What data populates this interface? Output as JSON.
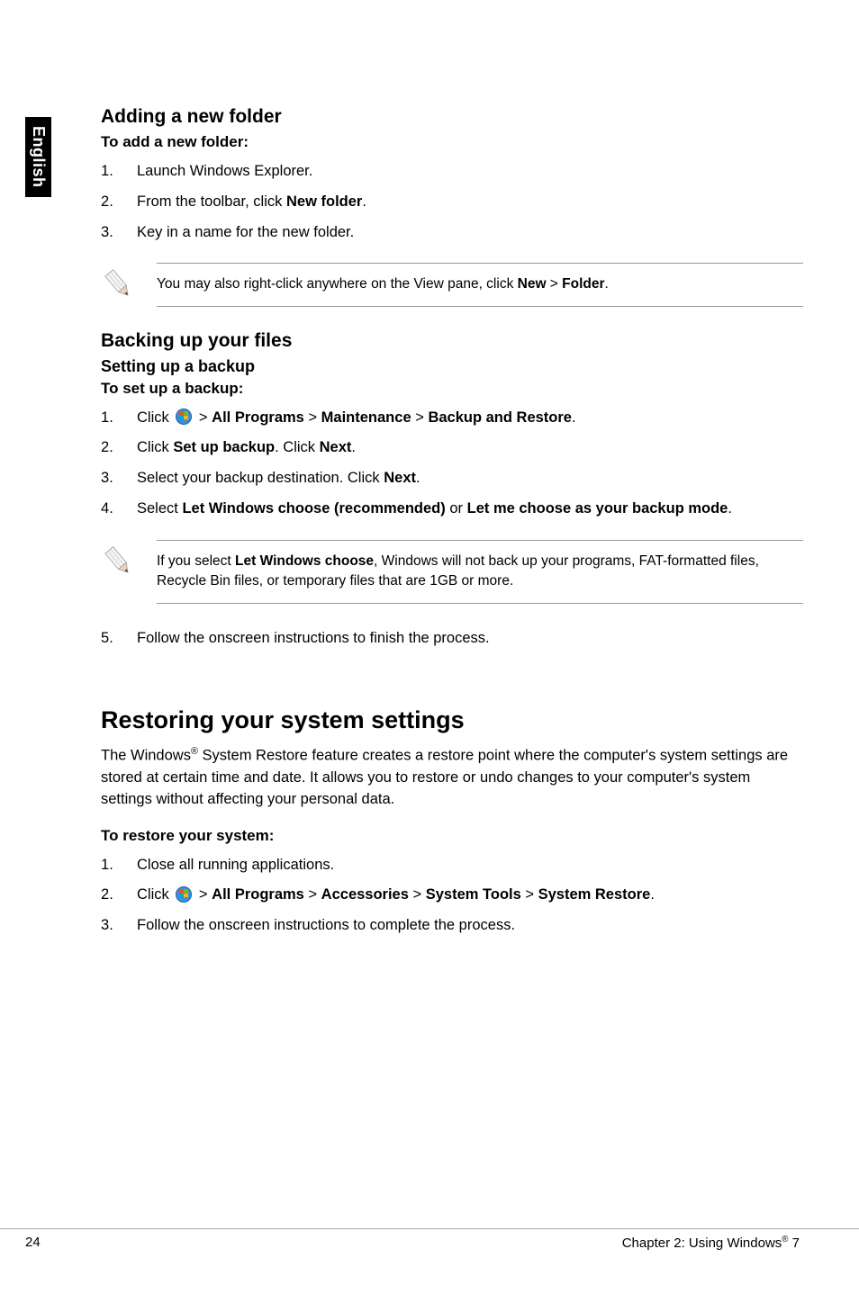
{
  "sideTab": "English",
  "adding": {
    "heading": "Adding a new folder",
    "sub": "To add a new folder:",
    "items": [
      "Launch Windows Explorer.",
      "From the toolbar, click <b>New folder</b>.",
      "Key in a name for the new folder."
    ],
    "note": "You may also right-click anywhere on the View pane, click <b>New</b> > <b>Folder</b>."
  },
  "backing": {
    "heading": "Backing up your files",
    "sub1": "Setting up a backup",
    "sub2": "To set up a backup:",
    "items": [
      "Click {WIN} > <b>All Programs</b> > <b>Maintenance</b> > <b>Backup and Restore</b>.",
      "Click <b>Set up backup</b>. Click <b>Next</b>.",
      "Select your backup destination. Click <b>Next</b>.",
      "Select <b>Let Windows choose (recommended)</b> or <b>Let me choose as your backup mode</b>."
    ],
    "note": "If you select <b>Let Windows choose</b>, Windows will not back up your programs, FAT-formatted files, Recycle Bin files, or temporary files that are 1GB or more.",
    "afterNote": "Follow the onscreen instructions to finish the process."
  },
  "restoring": {
    "heading": "Restoring your system settings",
    "body": "The Windows<span class=\"sup\">®</span> System Restore feature creates a restore point where the computer's system settings are stored at certain time and date. It allows you to restore or undo changes to your computer's system settings without affecting your personal data.",
    "sub": "To restore your system:",
    "items": [
      "Close all running applications.",
      "Click {WIN} > <b>All Programs</b> > <b>Accessories</b> > <b>System Tools</b> > <b>System Restore</b>.",
      "Follow the onscreen instructions to complete the process."
    ]
  },
  "footer": {
    "left": "24",
    "right": "Chapter 2: Using Windows<span class=\"sup\">®</span> 7"
  }
}
